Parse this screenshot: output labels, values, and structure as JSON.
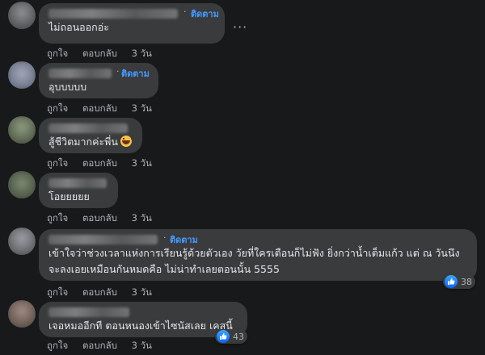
{
  "labels": {
    "follow": "ติดตาม",
    "like": "ถูกใจ",
    "reply": "ตอบกลับ",
    "follow_dot": "·"
  },
  "more_button": "···",
  "comments": [
    {
      "text": "ไม่ถอนออกอ่ะ",
      "time": "3 วัน",
      "reactions": ""
    },
    {
      "text": "อุบบบบบ",
      "time": "3 วัน",
      "reactions": ""
    },
    {
      "text": "สู้ชีวิตมากค่ะพี่น",
      "time": "3 วัน",
      "reactions": ""
    },
    {
      "text": "โอยยยยย",
      "time": "3 วัน",
      "reactions": ""
    },
    {
      "text_line1": "เข้าใจว่าช่วงเวลาแห่งการเรียนรู้ด้วยตัวเอง วัยที่ใครเตือนก็ไม่ฟัง ยิ่งกว่าน้ำเต็มแก้ว แต่ ณ วันนึง",
      "text_line2": "จะลงเอยเหมือนกันหมดคือ ไม่น่าทำเลยตอนนั้น 5555",
      "time": "3 วัน",
      "reactions": "38"
    },
    {
      "text": "เจอหมออีกที ตอนหนองเข้าไซนัสเลย เคสนี้",
      "time": "3 วัน",
      "reactions": "43"
    }
  ],
  "colors": {
    "background": "#18191a",
    "bubble": "#3a3b3c",
    "follow": "#4599ff",
    "like": "#0866ff",
    "muted": "#b0b3b8"
  },
  "icons": [
    "like-icon",
    "laughing-emoji-icon",
    "more-icon"
  ]
}
